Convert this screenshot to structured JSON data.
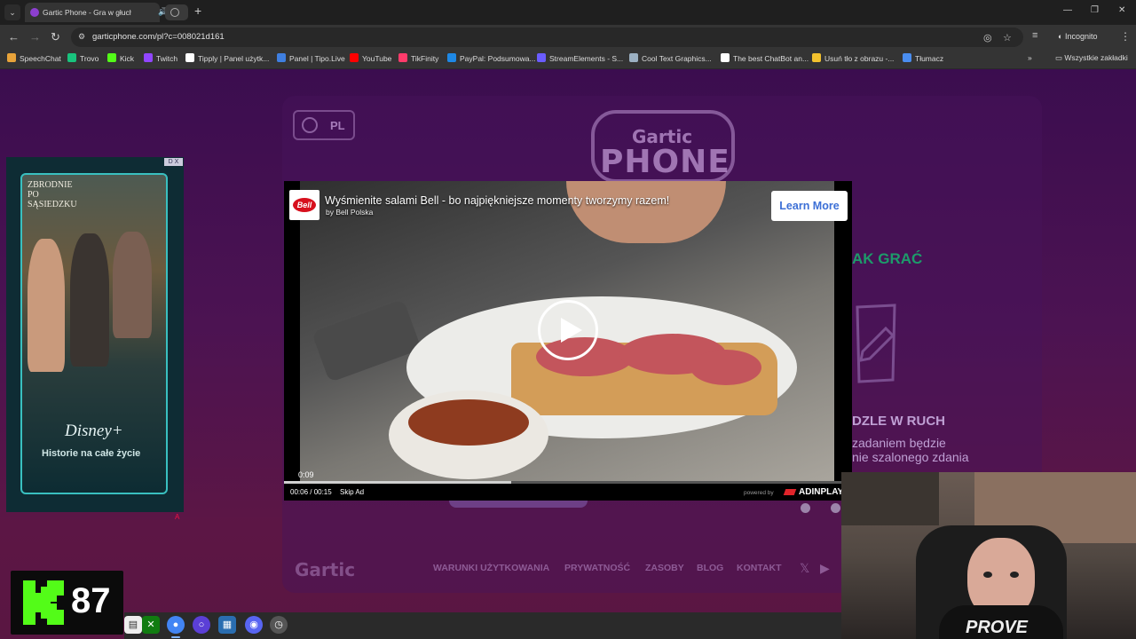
{
  "browser": {
    "tabs": [
      {
        "title": "Gartic Phone - Gra w głuche",
        "active": true
      },
      {
        "title": "",
        "active": false
      }
    ],
    "url": "garticphone.com/pl?c=008021d161",
    "incognito_label": "Incognito",
    "bookmarks": [
      {
        "label": "SpeechChat",
        "color": "#e8a33a"
      },
      {
        "label": "Trovo",
        "color": "#19c37d"
      },
      {
        "label": "Kick",
        "color": "#53fc18"
      },
      {
        "label": "Twitch",
        "color": "#9146ff"
      },
      {
        "label": "Tipply | Panel użytk...",
        "color": "#ffffff"
      },
      {
        "label": "Panel | Tipo.Live",
        "color": "#3f7fe0"
      },
      {
        "label": "YouTube",
        "color": "#ff0000"
      },
      {
        "label": "TikFinity",
        "color": "#ff3b6b"
      },
      {
        "label": "PayPal: Podsumowa...",
        "color": "#1e88e5"
      },
      {
        "label": "StreamElements - S...",
        "color": "#6a5cff"
      },
      {
        "label": "Cool Text Graphics...",
        "color": "#9bb0c2"
      },
      {
        "label": "The best ChatBot an...",
        "color": "#ffffff"
      },
      {
        "label": "Usuń tło z obrazu -...",
        "color": "#f2c12e"
      },
      {
        "label": "Tłumacz",
        "color": "#4a8df0"
      }
    ],
    "all_bookmarks_label": "Wszystkie zakładki"
  },
  "page": {
    "language_label": "PL",
    "logo_top": "Gartic",
    "logo_bottom": "PHONE",
    "how_to_play": "AK GRAĆ",
    "puzzle_title": "DZLE W RUCH",
    "puzzle_line1": "zadaniem będzie",
    "puzzle_line2": "nie szalonego zdania",
    "footer_logo": "Gartic",
    "footer_links": [
      "WARUNKI UŻYTKOWANIA",
      "PRYWATNOŚĆ",
      "ZASOBY",
      "BLOG",
      "KONTAKT"
    ]
  },
  "banner_ad": {
    "show_title": "ZBRODNIE PO SĄSIEDZKU",
    "brand": "Disney+",
    "tagline": "Historie na całe życie",
    "adchoice": "D X",
    "corner_mark": "A"
  },
  "video_ad": {
    "brand_logo": "Bell",
    "title": "Wyśmienite salami Bell - bo najpiękniejsze momenty tworzymy razem!",
    "by": "by Bell Polska",
    "cta": "Learn More",
    "inline_time": "0:09",
    "time": "00:06 / 00:15",
    "skip": "Skip Ad",
    "powered_by": "powered by",
    "network": "ADINPLAY",
    "progress": 0.4
  },
  "kick_counter": {
    "value": "87",
    "brand_color": "#53fc18"
  },
  "webcam": {
    "shirt_text": "PROVE"
  },
  "taskbar": {
    "icons": [
      "file-explorer-icon",
      "xbox-icon",
      "chrome-icon",
      "cortana-icon",
      "app-icon",
      "discord-icon",
      "clock-icon"
    ]
  }
}
